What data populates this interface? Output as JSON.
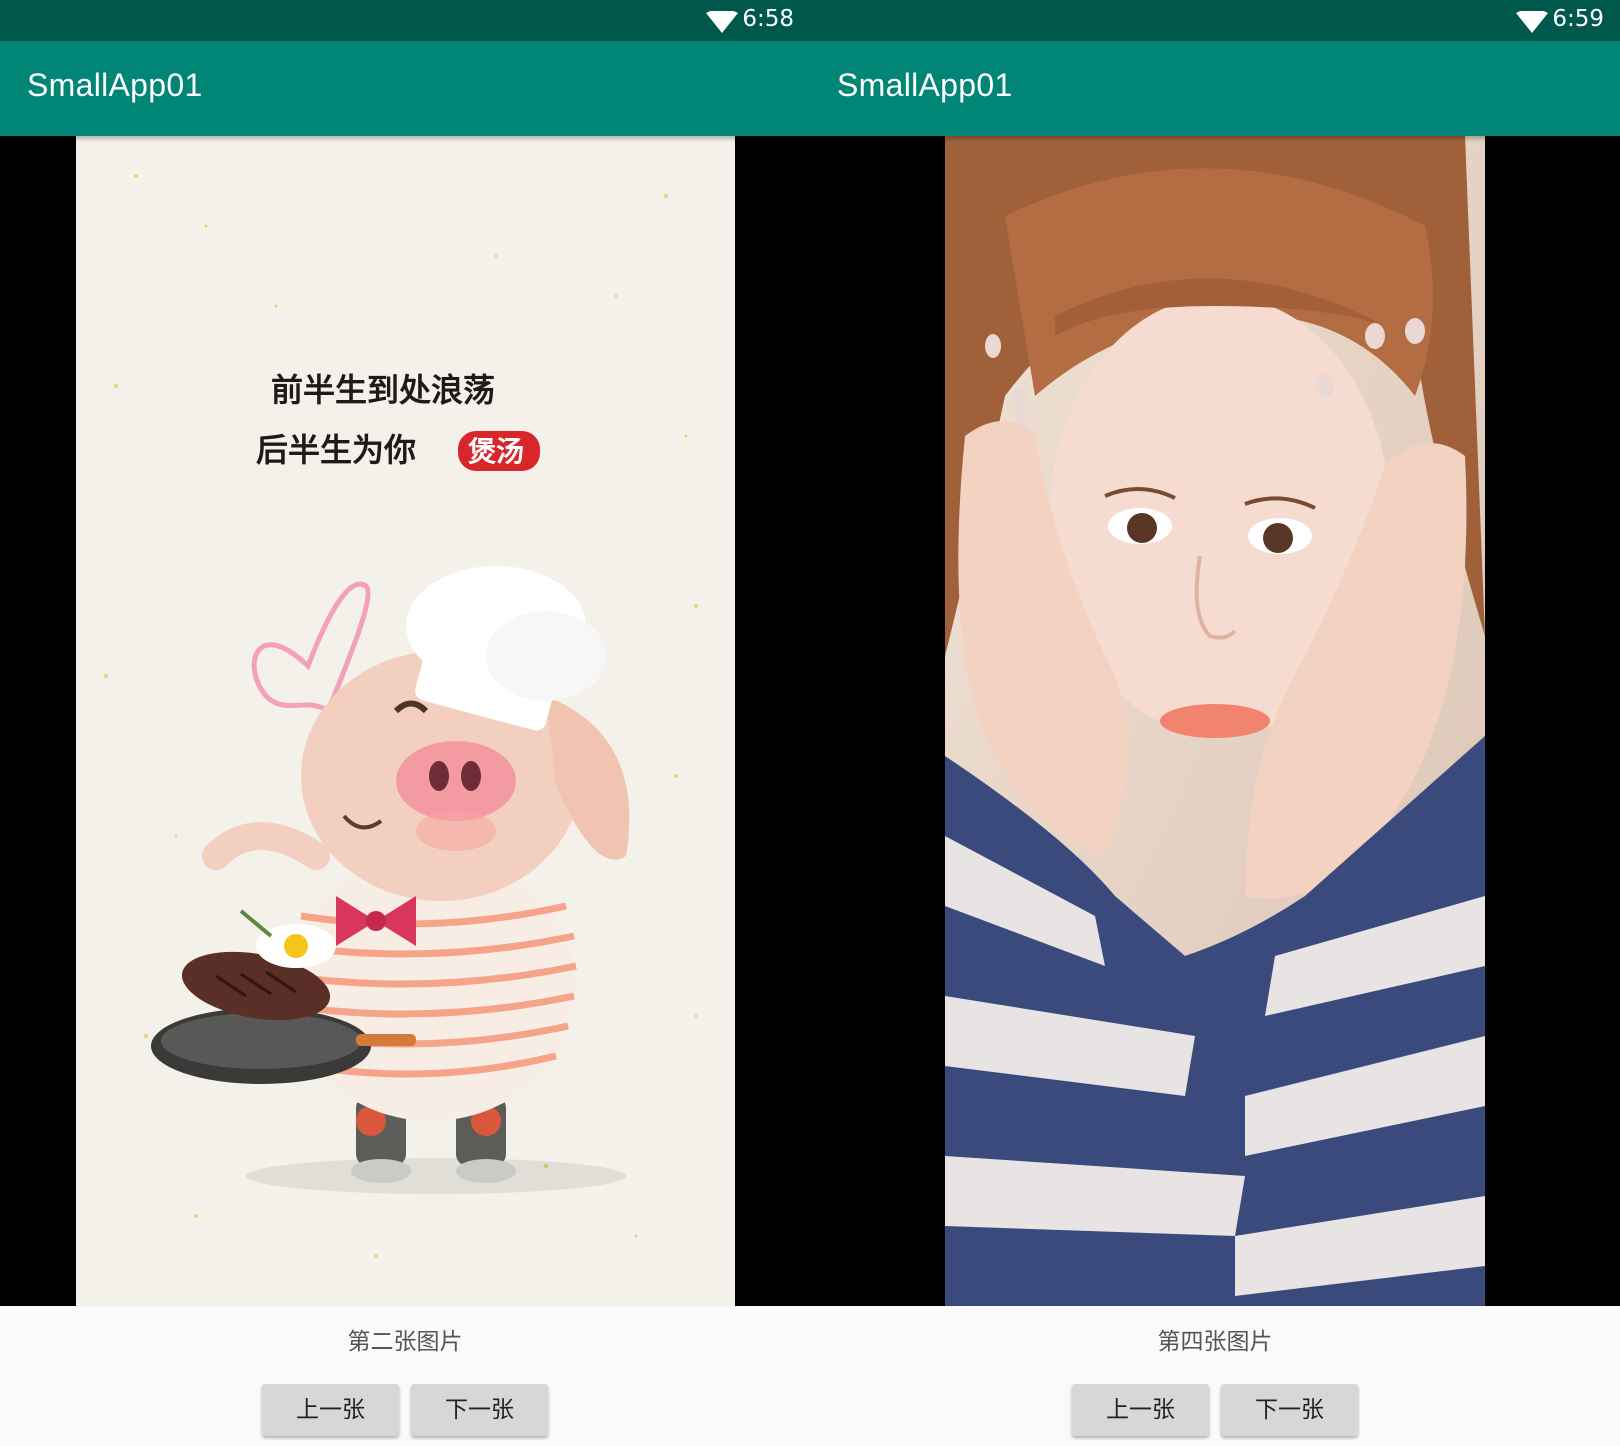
{
  "screens": [
    {
      "status": {
        "time": "6:58",
        "icon": "wifi-icon"
      },
      "app_title": "SmallApp01",
      "image": {
        "subject": "chef-pig-illustration",
        "text_lines": [
          "前半生到处浪荡",
          "后半生为你"
        ],
        "stamp_text": "煲汤"
      },
      "caption": "第二张图片",
      "prev_label": "上一张",
      "next_label": "下一张"
    },
    {
      "status": {
        "time": "6:59",
        "icon": "wifi-icon"
      },
      "app_title": "SmallApp01",
      "image": {
        "subject": "girl-portrait-photo"
      },
      "caption": "第四张图片",
      "prev_label": "上一张",
      "next_label": "下一张"
    }
  ],
  "colors": {
    "status_bar": "#00574b",
    "app_bar": "#008577",
    "button": "#d6d7d7",
    "stamp": "#d8262b"
  }
}
